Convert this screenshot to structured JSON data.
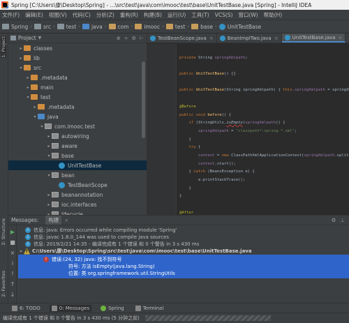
{
  "window": {
    "title": "Spring [C:\\Users\\康\\Desktop\\Spring] - ...\\src\\test\\java\\com\\imooc\\test\\base\\UnitTestBase.java [Spring] - IntelliJ IDEA"
  },
  "menu": [
    "文件(F)",
    "编辑(E)",
    "视图(V)",
    "代码(C)",
    "分析(Z)",
    "重构(R)",
    "构建(B)",
    "运行(U)",
    "工具(T)",
    "VCS(S)",
    "窗口(W)",
    "帮助(H)"
  ],
  "breadcrumb": [
    "Spring",
    "src",
    "test",
    "java",
    "com",
    "imooc",
    "test",
    "base",
    "UnitTestBase"
  ],
  "left_stripe": {
    "project": "1: Project",
    "structure": "2: Structure",
    "favorites": "2: Favorites"
  },
  "project_panel": {
    "title": "Project",
    "tree": [
      {
        "label": "classes",
        "indent": 1,
        "arrow": "▸",
        "icon": "folder-icon"
      },
      {
        "label": "lib",
        "indent": 1,
        "arrow": "▸",
        "icon": "folder-icon"
      },
      {
        "label": "src",
        "indent": 1,
        "arrow": "▾",
        "icon": "folder-icon"
      },
      {
        "label": ".metadata",
        "indent": 2,
        "arrow": "▸",
        "icon": "folder-icon"
      },
      {
        "label": "main",
        "indent": 2,
        "arrow": "▸",
        "icon": "folder-icon"
      },
      {
        "label": "test",
        "indent": 2,
        "arrow": "▾",
        "icon": "folder-icon"
      },
      {
        "label": ".metadata",
        "indent": 3,
        "arrow": "▸",
        "icon": "folder-icon"
      },
      {
        "label": "java",
        "indent": 3,
        "arrow": "▾",
        "icon": "source-folder-icon"
      },
      {
        "label": "com.imooc.test",
        "indent": 4,
        "arrow": "▾",
        "icon": "package-icon"
      },
      {
        "label": "autowiring",
        "indent": 5,
        "arrow": "▸",
        "icon": "package-icon"
      },
      {
        "label": "aware",
        "indent": 5,
        "arrow": "▸",
        "icon": "package-icon"
      },
      {
        "label": "base",
        "indent": 5,
        "arrow": "▾",
        "icon": "package-icon"
      },
      {
        "label": "UnitTestBase",
        "indent": 6,
        "arrow": "",
        "icon": "class-icon"
      },
      {
        "label": "bean",
        "indent": 5,
        "arrow": "▾",
        "icon": "package-icon"
      },
      {
        "label": "TestBeanScope",
        "indent": 6,
        "arrow": "",
        "icon": "class-icon"
      },
      {
        "label": "beanannotation",
        "indent": 5,
        "arrow": "▸",
        "icon": "package-icon"
      },
      {
        "label": "ioc.interfaces",
        "indent": 5,
        "arrow": "▸",
        "icon": "package-icon"
      },
      {
        "label": "lifecycle",
        "indent": 5,
        "arrow": "▸",
        "icon": "package-icon"
      },
      {
        "label": "resource",
        "indent": 5,
        "arrow": "▸",
        "icon": "package-icon"
      },
      {
        "label": "resources",
        "indent": 3,
        "arrow": "",
        "icon": "resources-folder-icon"
      },
      {
        "label": "classpath",
        "indent": 2,
        "arrow": "",
        "icon": "file-icon"
      }
    ]
  },
  "editor": {
    "tabs": [
      {
        "label": "TestBeanScope.java",
        "active": false
      },
      {
        "label": "BeanImplTwo.java",
        "active": false
      },
      {
        "label": "UnitTestBase.java",
        "active": true
      }
    ]
  },
  "messages": {
    "title": "Messages:",
    "subtab": "构建",
    "lines": [
      {
        "icon": "i",
        "text": "信息: java: Errors occurred while compiling module 'Spring'"
      },
      {
        "icon": "i",
        "text": "信息: javac 1.8.0_144 was used to compile java sources"
      },
      {
        "icon": "i",
        "text": "信息: 2019/2/21 14:35 - 编译完成有 1 个错误 和 0 个警告 in 3 s 430 ms"
      }
    ],
    "file_path": "C:\\Users\\康\\Desktop\\Spring\\src\\test\\java\\com\\imooc\\test\\base\\UnitTestBase.java",
    "error": {
      "headline": "错误:(24, 32)  java: 找不到符号",
      "symbol": "符号:   方法 isEmpty(java.lang.String)",
      "location": "位置: 类 org.springframework.util.StringUtils"
    }
  },
  "tool_tabs": [
    {
      "label": "6: TODO",
      "icon": "todo-icon",
      "active": false
    },
    {
      "label": "0: Messages",
      "icon": "messages-icon",
      "active": true
    },
    {
      "label": "Spring",
      "icon": "spring-icon",
      "active": false
    },
    {
      "label": "Terminal",
      "icon": "terminal-icon",
      "active": false
    }
  ],
  "status": {
    "text": "编译完成有 1 个错误 和 0 个警告 in 3 s 430 ms (5 分钟之前)"
  }
}
